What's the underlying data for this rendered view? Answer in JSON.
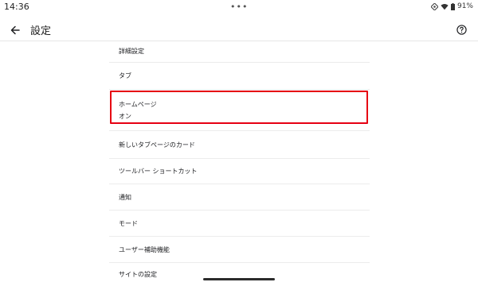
{
  "status_bar": {
    "time": "14:36",
    "center_dots": "•••",
    "battery_text": "91%"
  },
  "app_bar": {
    "title": "設定",
    "back_icon": "arrow-back-icon",
    "help_icon": "help-circle-icon"
  },
  "settings": {
    "items": [
      {
        "label": "詳細設定"
      },
      {
        "label": "タブ"
      },
      {
        "label": "ホームページ",
        "sub": "オン"
      },
      {
        "label": "新しいタブページのカード"
      },
      {
        "label": "ツールバー ショートカット"
      },
      {
        "label": "通知"
      },
      {
        "label": "モード"
      },
      {
        "label": "ユーザー補助機能"
      },
      {
        "label": "サイトの設定"
      }
    ]
  },
  "highlight": {
    "color": "#e60012",
    "target": "ホームページ"
  }
}
